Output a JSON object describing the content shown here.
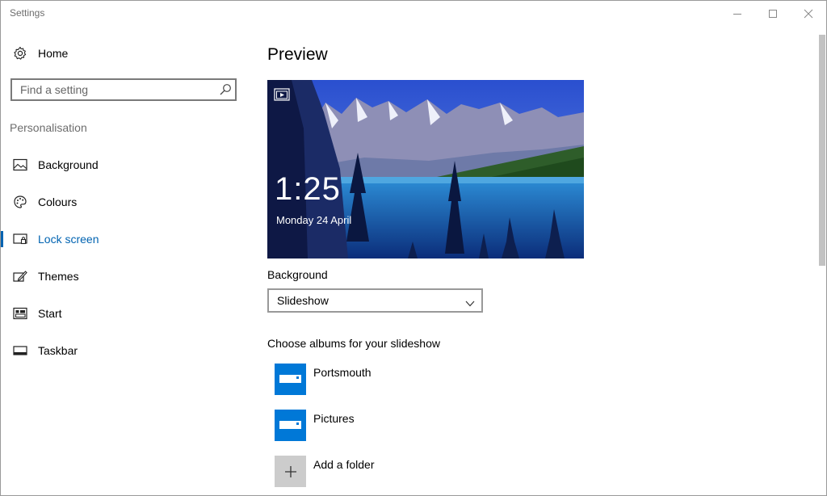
{
  "window": {
    "title": "Settings"
  },
  "sidebar": {
    "home_label": "Home",
    "search_placeholder": "Find a setting",
    "section": "Personalisation",
    "items": [
      {
        "label": "Background",
        "icon": "picture-icon"
      },
      {
        "label": "Colours",
        "icon": "palette-icon"
      },
      {
        "label": "Lock screen",
        "icon": "lock-screen-icon",
        "active": true
      },
      {
        "label": "Themes",
        "icon": "themes-icon"
      },
      {
        "label": "Start",
        "icon": "start-icon"
      },
      {
        "label": "Taskbar",
        "icon": "taskbar-icon"
      }
    ]
  },
  "main": {
    "title": "Preview",
    "preview": {
      "time": "1:25",
      "date": "Monday 24 April"
    },
    "background_label": "Background",
    "background_value": "Slideshow",
    "albums_label": "Choose albums for your slideshow",
    "albums": [
      "Portsmouth",
      "Pictures"
    ],
    "add_folder": "Add a folder"
  },
  "colors": {
    "accent": "#0063b1",
    "tile": "#0078d7"
  }
}
